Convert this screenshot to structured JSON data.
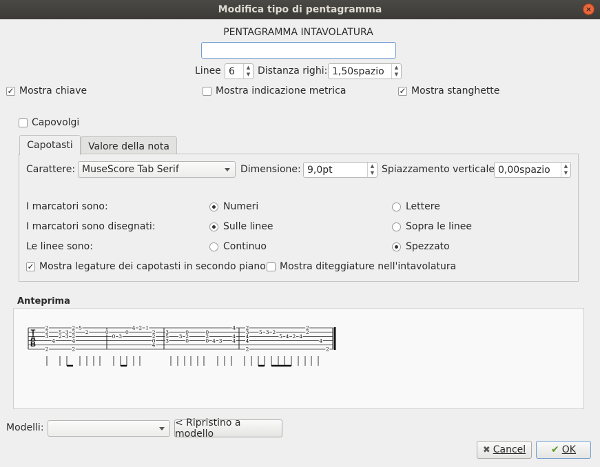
{
  "window": {
    "title": "Modifica tipo di pentagramma",
    "close_glyph": "×"
  },
  "header": {
    "staff_type_label": "PENTAGRAMMA INTAVOLATURA",
    "name_value": ""
  },
  "lines": {
    "label": "Linee",
    "value": "6"
  },
  "line_distance": {
    "label": "Distanza righi:",
    "value": "1,50spazio"
  },
  "checks_top": {
    "show_clef": {
      "label": "Mostra chiave",
      "checked": true,
      "glyph": "✓"
    },
    "show_time_sig": {
      "label": "Mostra indicazione metrica",
      "checked": false
    },
    "show_barlines": {
      "label": "Mostra stanghette",
      "checked": true,
      "glyph": "✓"
    }
  },
  "upside_down": {
    "label": "Capovolgi",
    "checked": false
  },
  "tabs": [
    {
      "label": "Capotasti"
    },
    {
      "label": "Valore della nota"
    }
  ],
  "frets": {
    "font_label": "Carattere:",
    "font_value": "MuseScore Tab Serif",
    "size_label": "Dimensione:",
    "size_value": "9,0pt",
    "offset_label": "Spiazzamento verticale",
    "offset_value": "0,00spazio",
    "markers_are": {
      "label": "I marcatori sono:",
      "opt1": "Numeri",
      "opt2": "Lettere"
    },
    "markers_drawn": {
      "label": "I marcatori sono disegnati:",
      "opt1": "Sulle linee",
      "opt2": "Sopra le linee"
    },
    "lines_are": {
      "label": "Le linee sono:",
      "opt1": "Continuo",
      "opt2": "Spezzato"
    },
    "show_back_ties": {
      "label": "Mostra legature dei capotasti in secondo piano",
      "checked": true,
      "glyph": "✓"
    },
    "show_fingering": {
      "label": "Mostra diteggiature nell'intavolatura",
      "checked": false
    }
  },
  "preview": {
    "title": "Anteprima",
    "clef": [
      "T",
      "A",
      "B"
    ],
    "fret_numbers": [
      {
        "t": "2",
        "m": 0,
        "s": 0
      },
      {
        "t": "2",
        "m": 0,
        "s": 1
      },
      {
        "t": "3",
        "m": 0,
        "s": 2
      },
      {
        "t": "2",
        "m": 0,
        "s": 5
      },
      {
        "t": "4",
        "m": 1,
        "s": 3
      },
      {
        "t": "5",
        "m": 2,
        "s": 1
      },
      {
        "t": "3",
        "m": 3,
        "s": 1
      },
      {
        "t": "2",
        "m": 4,
        "s": 1
      },
      {
        "t": "2",
        "m": 2,
        "s": 2
      },
      {
        "t": "3",
        "m": 3,
        "s": 2
      },
      {
        "t": "5",
        "m": 5,
        "s": 0
      },
      {
        "t": "2",
        "m": 6,
        "s": 1
      },
      {
        "t": "2",
        "m": 4,
        "s": 0
      },
      {
        "t": "2",
        "m": 4,
        "s": 2
      },
      {
        "t": "4",
        "m": 4,
        "s": 3
      },
      {
        "t": "2",
        "m": 4,
        "s": 5
      },
      {
        "t": "0",
        "m": 9,
        "s": 1
      },
      {
        "t": "0",
        "m": 10,
        "s": 2
      },
      {
        "t": "3",
        "m": 11,
        "s": 2
      },
      {
        "t": "0",
        "m": 12,
        "s": 1
      },
      {
        "t": "4",
        "m": 13,
        "s": 0
      },
      {
        "t": "2",
        "m": 14,
        "s": 0
      },
      {
        "t": "1",
        "m": 15,
        "s": 0
      },
      {
        "t": "2",
        "m": 16,
        "s": 1
      },
      {
        "t": "2",
        "m": 16,
        "s": 2
      },
      {
        "t": "0",
        "m": 16,
        "s": 3
      },
      {
        "t": "4",
        "m": 16,
        "s": 4
      },
      {
        "t": "3",
        "m": 18,
        "s": 1
      },
      {
        "t": "5",
        "m": 18,
        "s": 2
      },
      {
        "t": "3",
        "m": 18,
        "s": 3
      },
      {
        "t": "3",
        "m": 20,
        "s": 2
      },
      {
        "t": "0",
        "m": 21,
        "s": 1
      },
      {
        "t": "2",
        "m": 21,
        "s": 2
      },
      {
        "t": "0",
        "m": 21,
        "s": 3
      },
      {
        "t": "0",
        "m": 24,
        "s": 1
      },
      {
        "t": "2",
        "m": 24,
        "s": 2
      },
      {
        "t": "0",
        "m": 24,
        "s": 3
      },
      {
        "t": "4",
        "m": 25,
        "s": 3
      },
      {
        "t": "3",
        "m": 26,
        "s": 3
      },
      {
        "t": "4",
        "m": 28,
        "s": 0
      },
      {
        "t": "4",
        "m": 28,
        "s": 2
      },
      {
        "t": "4",
        "m": 28,
        "s": 3
      },
      {
        "t": "2",
        "m": 30,
        "s": 0
      },
      {
        "t": "3",
        "m": 30,
        "s": 1
      },
      {
        "t": "4",
        "m": 30,
        "s": 2
      },
      {
        "t": "4",
        "m": 30,
        "s": 3
      },
      {
        "t": "2",
        "m": 30,
        "s": 5
      },
      {
        "t": "5",
        "m": 32,
        "s": 1
      },
      {
        "t": "3",
        "m": 33,
        "s": 1
      },
      {
        "t": "2",
        "m": 34,
        "s": 1
      },
      {
        "t": "5",
        "m": 35,
        "s": 2
      },
      {
        "t": "4",
        "m": 36,
        "s": 2
      },
      {
        "t": "2",
        "m": 37,
        "s": 2
      },
      {
        "t": "4",
        "m": 38,
        "s": 2
      },
      {
        "t": "2",
        "m": 39,
        "s": 0
      },
      {
        "t": "2",
        "m": 39,
        "s": 1
      },
      {
        "t": "4",
        "m": 41,
        "s": 3
      },
      {
        "t": "2",
        "m": 42,
        "s": 5
      }
    ]
  },
  "footer": {
    "templates_label": "Modelli:",
    "templates_value": "",
    "reset_label": "< Ripristino a modello",
    "cancel_label": "Cancel",
    "cancel_glyph": "✖",
    "ok_label": "OK",
    "ok_glyph": "✔"
  }
}
